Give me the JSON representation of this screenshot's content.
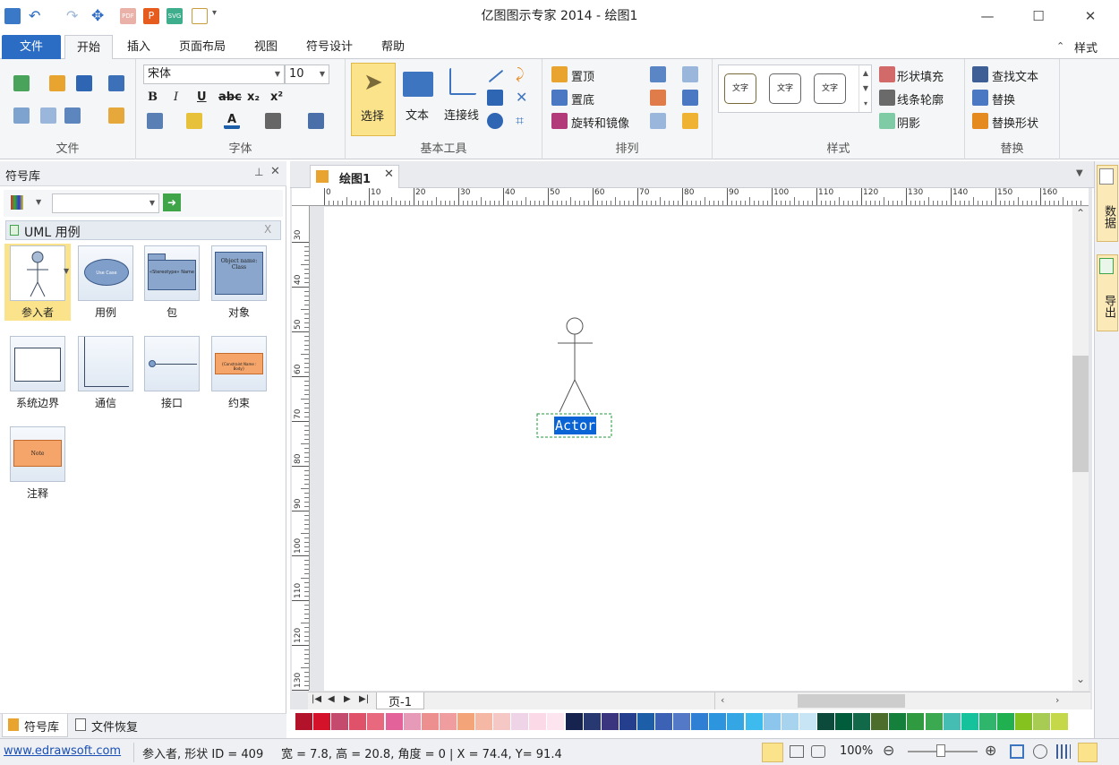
{
  "app": {
    "title": "亿图图示专家 2014 - 绘图1"
  },
  "window_controls": {
    "minimize": "—",
    "maximize": "☐",
    "close": "✕"
  },
  "tabs": {
    "file": "文件",
    "items": [
      "开始",
      "插入",
      "页面布局",
      "视图",
      "符号设计",
      "帮助"
    ],
    "active": "开始",
    "style_label": "样式"
  },
  "ribbon": {
    "file_group": "文件",
    "font_group": {
      "label": "字体",
      "font_name": "宋体",
      "font_size": "10",
      "bold": "B",
      "italic": "I",
      "underline": "U",
      "strike": "abc",
      "sub": "x₂",
      "sup": "x²"
    },
    "tools_group": {
      "label": "基本工具",
      "select": "选择",
      "text": "文本",
      "connector": "连接线"
    },
    "arrange_group": {
      "label": "排列",
      "bring_top": "置顶",
      "send_bottom": "置底",
      "rotate": "旋转和镜像"
    },
    "style_group": {
      "label": "样式",
      "preview": [
        "文字",
        "文字",
        "文字"
      ],
      "fill": "形状填充",
      "line": "线条轮廓",
      "shadow": "阴影"
    },
    "replace_group": {
      "label": "替换",
      "find": "查找文本",
      "replace": "替换",
      "replace_shape": "替换形状"
    }
  },
  "library": {
    "title": "符号库",
    "category": "UML 用例",
    "shapes": [
      {
        "label": "参入者",
        "icon": "actor-icon",
        "inner": ""
      },
      {
        "label": "用例",
        "icon": "usecase-icon",
        "inner": "Use Case"
      },
      {
        "label": "包",
        "icon": "package-icon",
        "inner": "«Stereotype» Name"
      },
      {
        "label": "对象",
        "icon": "object-icon",
        "inner": "Object name: Class"
      },
      {
        "label": "系统边界",
        "icon": "system-boundary-icon",
        "inner": ""
      },
      {
        "label": "通信",
        "icon": "communication-icon",
        "inner": ""
      },
      {
        "label": "接口",
        "icon": "interface-icon",
        "inner": ""
      },
      {
        "label": "约束",
        "icon": "constraint-icon",
        "inner": "{Constraint Name : Body}"
      },
      {
        "label": "注释",
        "icon": "note-icon",
        "inner": "Note"
      }
    ],
    "bottom_tabs": [
      "符号库",
      "文件恢复"
    ]
  },
  "document": {
    "tab": "绘图1",
    "actor_label": "Actor",
    "page_tab": "页-1"
  },
  "rulers": {
    "h": [
      "0",
      "10",
      "20",
      "30",
      "40",
      "50",
      "60",
      "70",
      "80",
      "90",
      "100",
      "110",
      "120",
      "130",
      "140",
      "150",
      "160"
    ],
    "v": [
      "30",
      "40",
      "50",
      "60",
      "70",
      "80",
      "90",
      "100",
      "110",
      "120",
      "130"
    ]
  },
  "right_tabs": [
    "数据",
    "导出"
  ],
  "palette": [
    "#b3122b",
    "#d4132a",
    "#c44a6e",
    "#e0516a",
    "#e8697e",
    "#e3629a",
    "#e79ab8",
    "#ee8f8f",
    "#f09da0",
    "#f3a479",
    "#f4b8a5",
    "#f5c8c5",
    "#efd3e6",
    "#fbd9e6",
    "#fce5ef",
    "#16234f",
    "#283870",
    "#3b3580",
    "#243f8e",
    "#1d5ea8",
    "#3b62b4",
    "#5479c7",
    "#2f7fd5",
    "#2c95dd",
    "#34a6e3",
    "#3dbbee",
    "#8cc6ed",
    "#a8d3ef",
    "#c7e5f4",
    "#0c4a3b",
    "#005c3b",
    "#12694a",
    "#4d6d2d",
    "#15803c",
    "#2f9a3f",
    "#3aa94f",
    "#45bdb3",
    "#15c29b",
    "#2fb66c",
    "#20b050",
    "#86c21f",
    "#a8cc53",
    "#c4d84a"
  ],
  "status": {
    "link": "www.edrawsoft.com",
    "info": "参入者, 形状 ID = 409",
    "dims": "宽 = 7.8, 高 = 20.8, 角度 = 0 | X = 74.4, Y= 91.4",
    "zoom": "100%"
  }
}
